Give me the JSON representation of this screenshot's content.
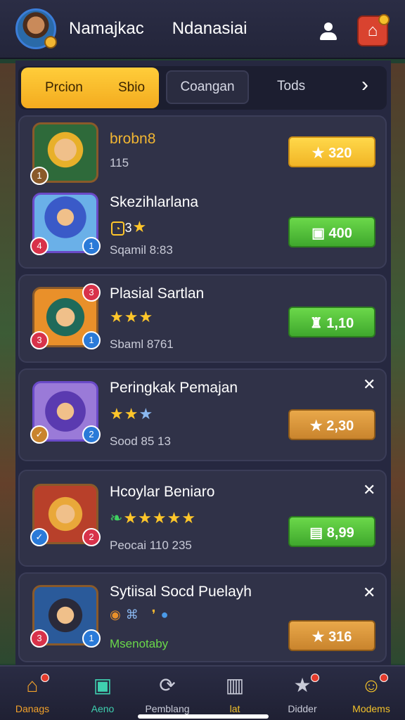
{
  "header": {
    "name": "Namajkac",
    "subtitle": "Ndanasiai",
    "user_icon": "user-icon",
    "home_icon": "home-icon"
  },
  "tabs": {
    "active_left": "Prcion",
    "active_right": "Sbio",
    "middle": "Coangan",
    "right": "Tods",
    "arrow": "›"
  },
  "cards": [
    {
      "title": "brobn8",
      "meta": "115",
      "price": "320",
      "portrait_badge": "1"
    },
    {
      "title": "Skezihlarlana",
      "meta": "Sqamil 8:83",
      "level": "3",
      "price": "400",
      "badge_left": "4",
      "badge_right": "1"
    },
    {
      "title": "Plasial Sartlan",
      "meta": "Sbaml 8761",
      "price": "1,10",
      "badge_left": "3",
      "badge_right": "1",
      "badge_top": "3"
    },
    {
      "title": "Peringkak Pemajan",
      "meta": "Sood 85 13",
      "price": "2,30",
      "badge_right": "2"
    },
    {
      "title": "Hcoylar Beniaro",
      "meta": "Peocai 110 235",
      "price": "8,99",
      "badge_right": "2"
    },
    {
      "title": "Sytiisal Socd Puelayh",
      "meta": "Msenotaby",
      "price": "316",
      "badge_left": "3",
      "badge_right": "1"
    }
  ],
  "nav": [
    {
      "label": "Danags",
      "icon": "house-icon",
      "color": "#f2a12a"
    },
    {
      "label": "Aeno",
      "icon": "gem-icon",
      "color": "#3fd0b0"
    },
    {
      "label": "Pemblang",
      "icon": "refresh-icon",
      "color": "#c9cbd8"
    },
    {
      "label": "lat",
      "icon": "chart-icon",
      "color": "#f2c12a"
    },
    {
      "label": "Didder",
      "icon": "star-icon",
      "color": "#c9cbd8"
    },
    {
      "label": "Modems",
      "icon": "smile-icon",
      "color": "#f2c12a"
    }
  ],
  "colors": {
    "accent_gold": "#f3ab1f",
    "accent_green": "#3fa82d",
    "panel": "#262840"
  }
}
